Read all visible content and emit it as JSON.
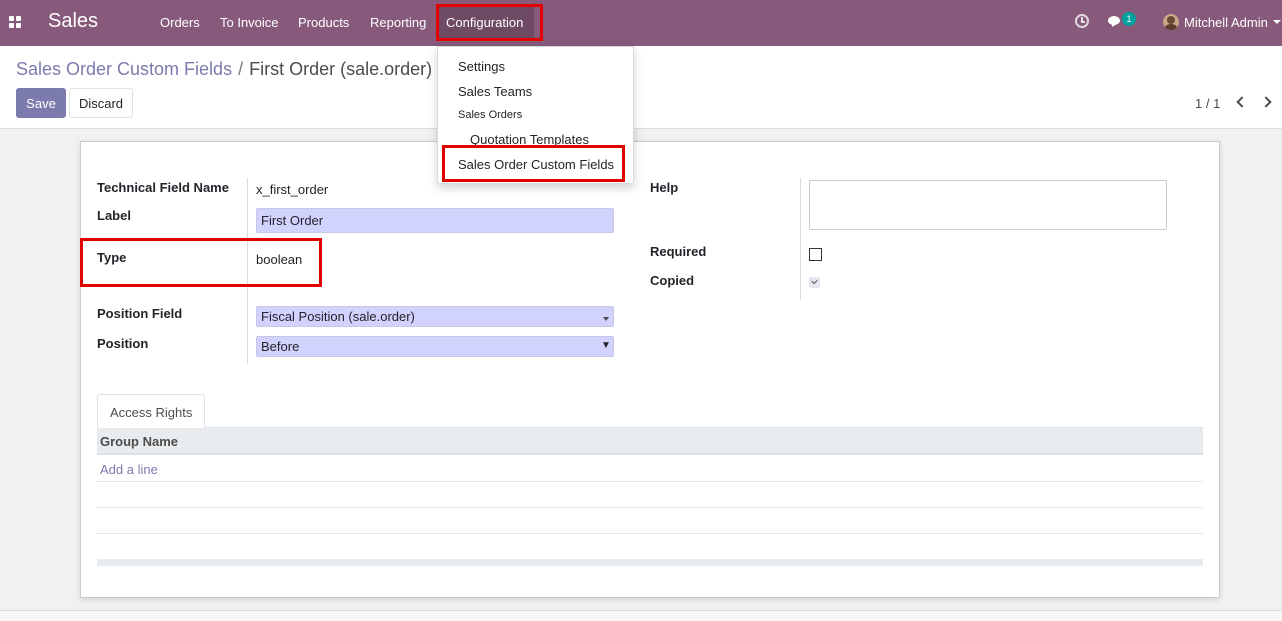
{
  "navbar": {
    "app_name": "Sales",
    "menu": [
      "Orders",
      "To Invoice",
      "Products",
      "Reporting",
      "Configuration"
    ],
    "chat_count": "1",
    "user_name": "Mitchell Admin"
  },
  "breadcrumb": {
    "parent": "Sales Order Custom Fields",
    "separator": "/",
    "current": "First Order (sale.order)"
  },
  "buttons": {
    "save": "Save",
    "discard": "Discard"
  },
  "pager": {
    "value": "1 / 1"
  },
  "dropdown": {
    "items": [
      "Settings",
      "Sales Teams"
    ],
    "section_header": "Sales Orders",
    "sub_items": [
      "Quotation Templates",
      "Sales Order Custom Fields"
    ]
  },
  "form": {
    "technical_field_name": {
      "label": "Technical Field Name",
      "value": "x_first_order"
    },
    "label_field": {
      "label": "Label",
      "value": "First Order"
    },
    "type": {
      "label": "Type",
      "value": "boolean"
    },
    "position_field": {
      "label": "Position Field",
      "value": "Fiscal Position (sale.order)"
    },
    "position": {
      "label": "Position",
      "value": "Before"
    },
    "help": {
      "label": "Help",
      "value": ""
    },
    "required": {
      "label": "Required",
      "checked": false
    },
    "copied": {
      "label": "Copied",
      "checked": true
    }
  },
  "tabs": {
    "access_rights": "Access Rights"
  },
  "table": {
    "column_group_name": "Group Name",
    "add_line": "Add a line"
  },
  "colors": {
    "navbar": "#875a7b",
    "accent": "#7c7bad",
    "highlight": "#e00000",
    "input_bg": "#d2d2ff"
  }
}
